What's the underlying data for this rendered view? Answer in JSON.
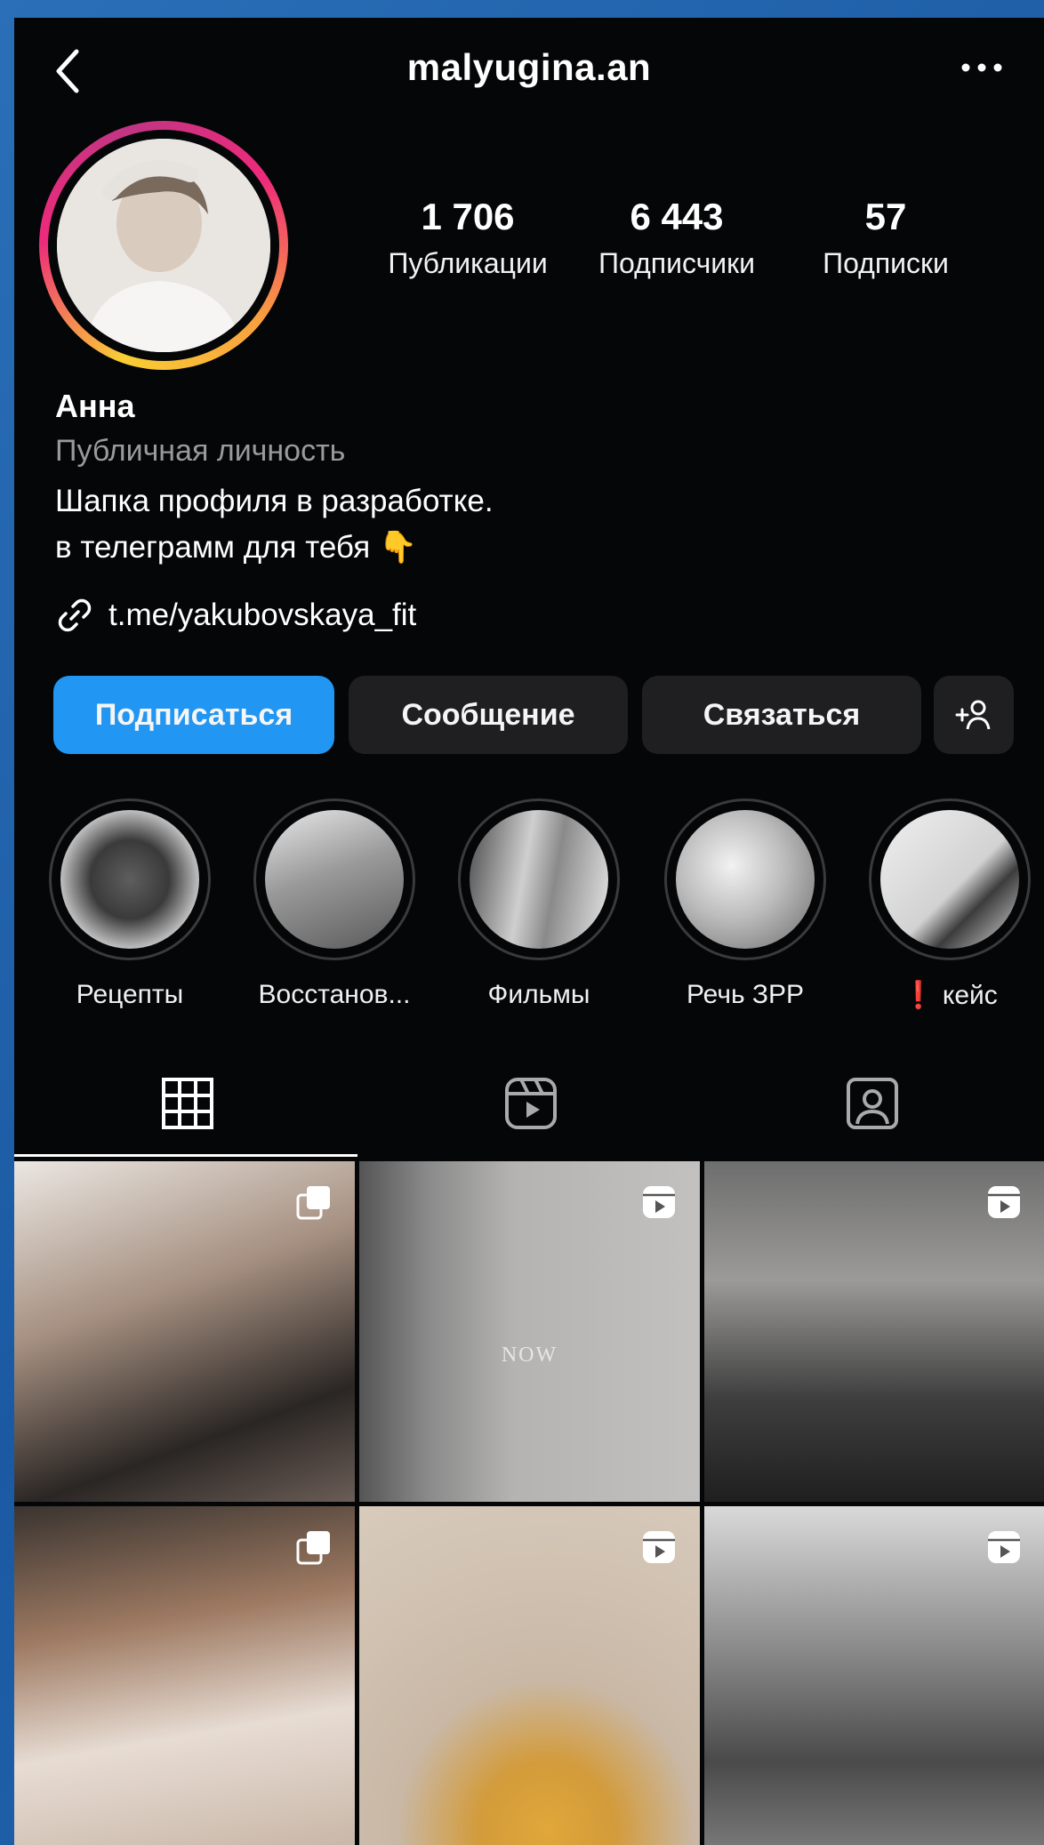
{
  "header": {
    "username": "malyugina.an",
    "back_icon": "chevron-left-icon",
    "menu_icon": "more-horizontal-icon"
  },
  "stats": [
    {
      "value": "1 706",
      "label": "Публикации"
    },
    {
      "value": "6 443",
      "label": "Подписчики"
    },
    {
      "value": "57",
      "label": "Подписки"
    }
  ],
  "profile": {
    "name": "Анна",
    "category": "Публичная личность",
    "bio_line1": "Шапка профиля в разработке.",
    "bio_line2": "в телеграмм для тебя 👇",
    "link": "t.me/yakubovskaya_fit"
  },
  "buttons": {
    "follow": "Подписаться",
    "message": "Сообщение",
    "contact": "Связаться",
    "add_user_icon": "add-person-icon"
  },
  "highlights": [
    {
      "label": "Рецепты"
    },
    {
      "label": "Восстанов..."
    },
    {
      "label": "Фильмы"
    },
    {
      "label": "Речь ЗРР"
    },
    {
      "label": "❗ кейс"
    }
  ],
  "tabs": [
    "grid-icon",
    "reels-icon",
    "tagged-icon"
  ],
  "grid": {
    "tiles": [
      {
        "type": "carousel"
      },
      {
        "type": "reel",
        "caption": "NOW"
      },
      {
        "type": "reel"
      },
      {
        "type": "carousel"
      },
      {
        "type": "reel"
      },
      {
        "type": "reel"
      }
    ]
  },
  "colors": {
    "accent": "#2196f3",
    "background": "#050607",
    "button": "#1f1f22"
  }
}
